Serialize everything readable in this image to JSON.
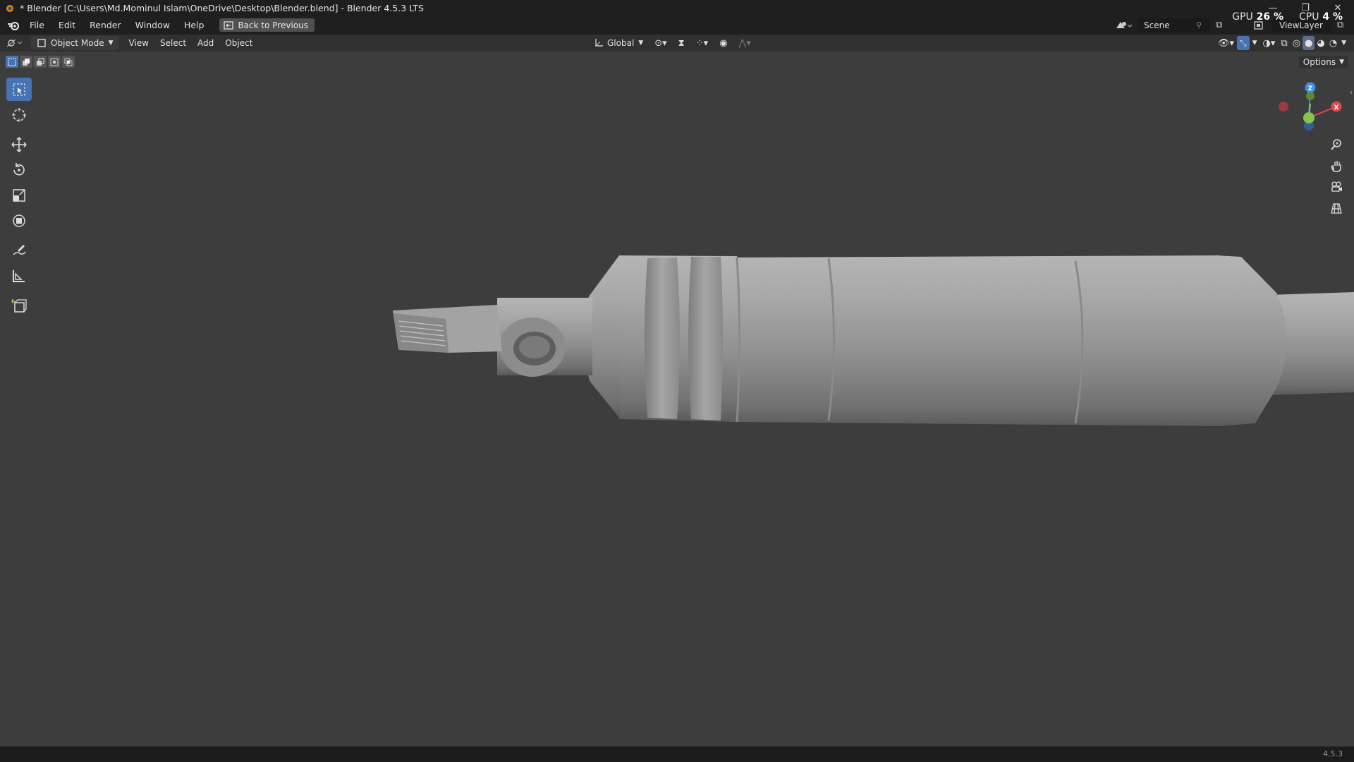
{
  "window": {
    "title": "* Blender [C:\\Users\\Md.Mominul Islam\\OneDrive\\Desktop\\Blender.blend] - Blender 4.5.3 LTS",
    "minimize": "—",
    "maximize": "❐",
    "close": "✕"
  },
  "menu": {
    "items": [
      "File",
      "Edit",
      "Render",
      "Window",
      "Help"
    ],
    "back_button": "Back to Previous"
  },
  "topright": {
    "scene": "Scene",
    "view_layer": "ViewLayer",
    "gpu_label": "GPU",
    "gpu_value": "26 %",
    "cpu_label": "CPU",
    "cpu_value": "4 %"
  },
  "viewport_header": {
    "mode": "Object Mode",
    "menus": [
      "View",
      "Select",
      "Add",
      "Object"
    ],
    "orientation": "Global",
    "options": "Options"
  },
  "statusbar": {
    "version": "4.5.3"
  },
  "colors": {
    "accent": "#4772b3",
    "background": "#3d3d3d",
    "axis_x": "#e0474f",
    "axis_y": "#8bc34a",
    "axis_z": "#3f8ee8"
  }
}
